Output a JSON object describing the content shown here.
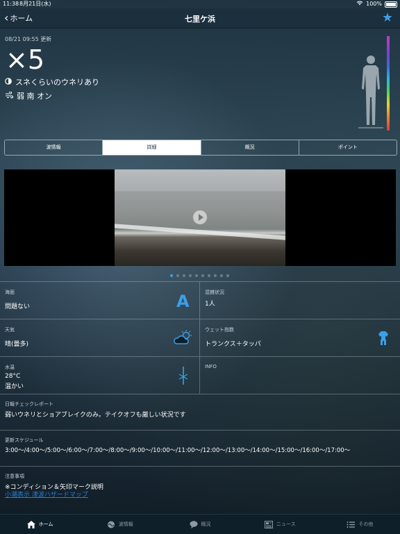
{
  "status": {
    "time": "11:38",
    "date": "8月21日(水)",
    "battery": "100%"
  },
  "nav": {
    "back_label": "ホーム",
    "title": "七里ケ浜"
  },
  "report": {
    "updated": "08/21 09:55 更新",
    "wave_size": "×5",
    "wave_desc": "スネくらいのウネリあり",
    "wind_desc": "弱 南 オン"
  },
  "tabs": [
    {
      "label": "波情報"
    },
    {
      "label": "詳細",
      "active": true
    },
    {
      "label": "概況"
    },
    {
      "label": "ポイント"
    }
  ],
  "carousel": {
    "count": 10,
    "active_index": 0
  },
  "details": {
    "surface": {
      "label": "海面",
      "value": "問題ない",
      "grade": "A"
    },
    "crowd": {
      "label": "混雑状況",
      "value": "1人"
    },
    "weather": {
      "label": "天気",
      "value": "晴(曇多)"
    },
    "wetsuit": {
      "label": "ウェット指数",
      "value": "トランクス＋タッパ"
    },
    "water_temp": {
      "label": "水温",
      "value": "28°C",
      "note": "温かい"
    },
    "info": {
      "label": "INFO"
    }
  },
  "daily": {
    "label": "日報チェックレポート",
    "value": "弱いウネリとショアブレイクのみ。テイクオフも厳しい状況です"
  },
  "schedule": {
    "label": "更新スケジュール",
    "value": "3:00〜/4:00〜/5:00〜/6:00〜/7:00〜/8:00〜/9:00〜/10:00〜/11:00〜/12:00〜/13:00〜/14:00〜/15:00〜/16:00〜/17:00〜"
  },
  "notes": {
    "label": "注意事項",
    "value": "※コンディション＆矢印マーク説明",
    "link": "小潮表示 津波ハザードマップ"
  },
  "tabbar": [
    {
      "label": "ホーム",
      "icon": "home-icon",
      "active": true
    },
    {
      "label": "波情報",
      "icon": "wave-icon"
    },
    {
      "label": "概況",
      "icon": "chat-icon"
    },
    {
      "label": "ニュース",
      "icon": "news-icon"
    },
    {
      "label": "その他",
      "icon": "list-icon"
    }
  ],
  "colors": {
    "accent": "#3aa0e8",
    "navbar": "#1b2f3d"
  }
}
